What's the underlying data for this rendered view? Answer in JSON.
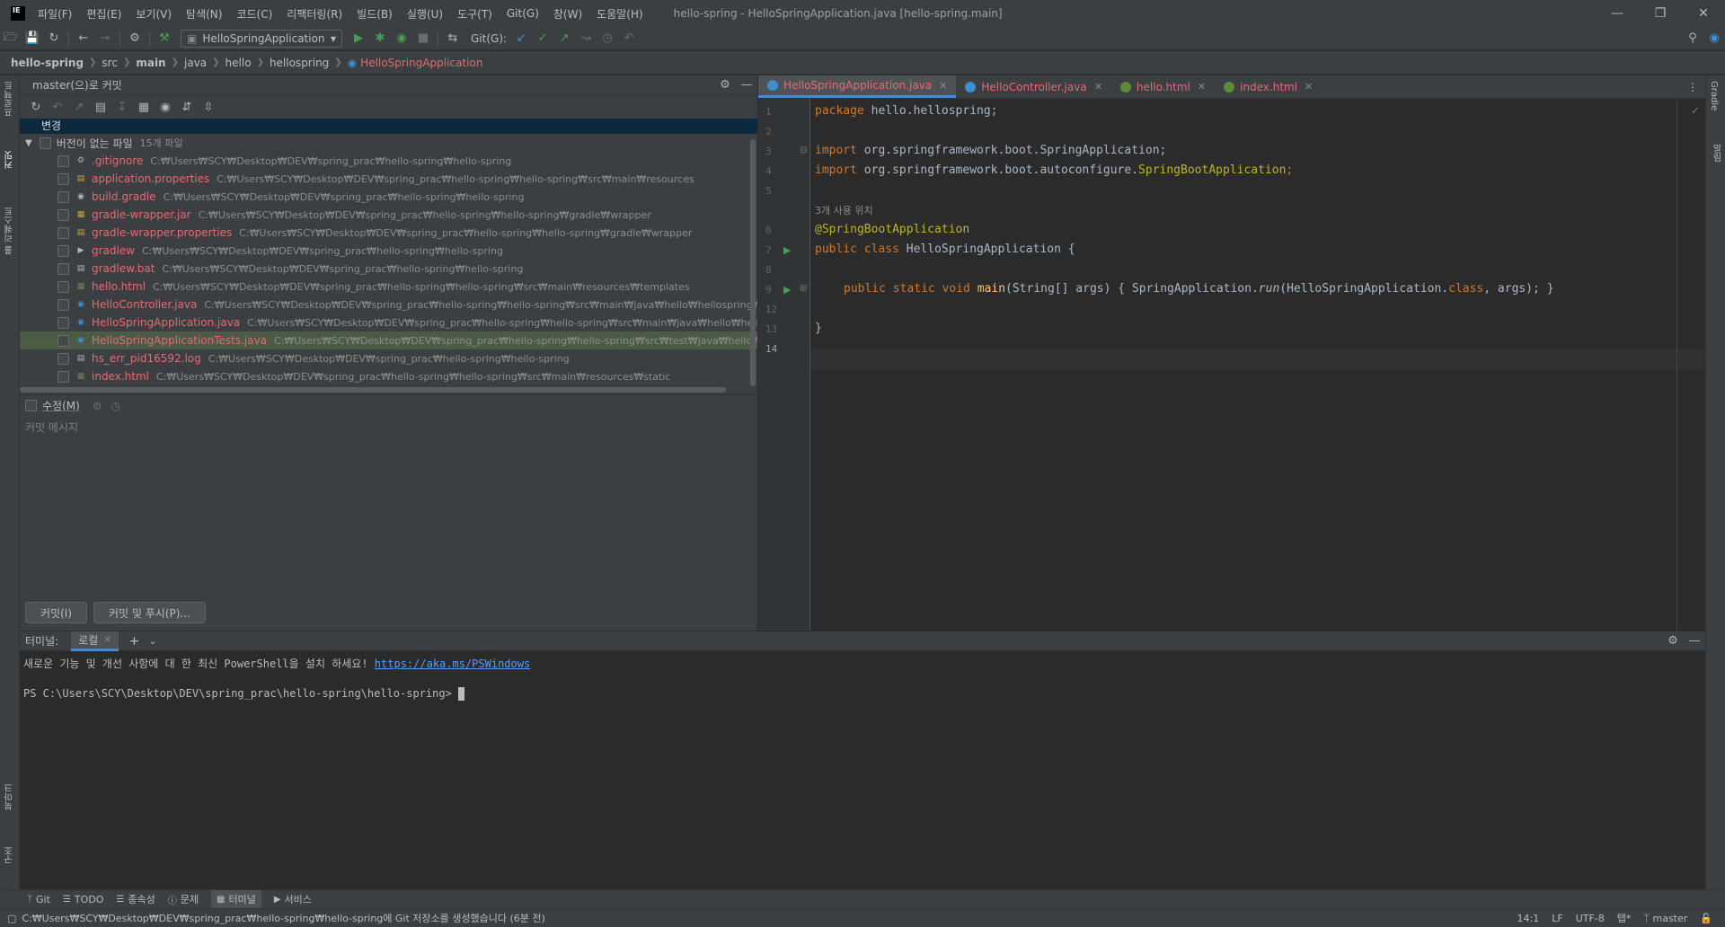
{
  "titlebar": {
    "logo": "IE",
    "menus": [
      "파일(F)",
      "편집(E)",
      "보기(V)",
      "탐색(N)",
      "코드(C)",
      "리팩터링(R)",
      "빌드(B)",
      "실행(U)",
      "도구(T)",
      "Git(G)",
      "창(W)",
      "도움말(H)"
    ],
    "window_title": "hello-spring - HelloSpringApplication.java [hello-spring.main]"
  },
  "toolbar": {
    "run_config": "HelloSpringApplication",
    "git_label": "Git(G):"
  },
  "breadcrumb": [
    "hello-spring",
    "src",
    "main",
    "java",
    "hello",
    "hellospring",
    "HelloSpringApplication"
  ],
  "left_strip": {
    "project": "프로젝트",
    "commit": "커밋",
    "pull_requests": "풀 리퀘스트",
    "bookmarks": "북마크",
    "structure": "구조"
  },
  "right_strip": {
    "gradle": "Gradle",
    "notifications": "알림"
  },
  "commit_panel": {
    "title": "master(으)로 커밋",
    "changes_header": "변경",
    "group_label": "버전이 없는 파일",
    "group_count": "15개 파일",
    "files": [
      {
        "name": ".gitignore",
        "path": "C:₩Users₩SCY₩Desktop₩DEV₩spring_prac₩hello-spring₩hello-spring",
        "icon": "gear-file-icon"
      },
      {
        "name": "application.properties",
        "path": "C:₩Users₩SCY₩Desktop₩DEV₩spring_prac₩hello-spring₩hello-spring₩src₩main₩resources",
        "icon": "properties-file-icon"
      },
      {
        "name": "build.gradle",
        "path": "C:₩Users₩SCY₩Desktop₩DEV₩spring_prac₩hello-spring₩hello-spring",
        "icon": "gradle-file-icon"
      },
      {
        "name": "gradle-wrapper.jar",
        "path": "C:₩Users₩SCY₩Desktop₩DEV₩spring_prac₩hello-spring₩hello-spring₩gradle₩wrapper",
        "icon": "jar-file-icon"
      },
      {
        "name": "gradle-wrapper.properties",
        "path": "C:₩Users₩SCY₩Desktop₩DEV₩spring_prac₩hello-spring₩hello-spring₩gradle₩wrapper",
        "icon": "properties-file-icon"
      },
      {
        "name": "gradlew",
        "path": "C:₩Users₩SCY₩Desktop₩DEV₩spring_prac₩hello-spring₩hello-spring",
        "icon": "script-file-icon"
      },
      {
        "name": "gradlew.bat",
        "path": "C:₩Users₩SCY₩Desktop₩DEV₩spring_prac₩hello-spring₩hello-spring",
        "icon": "bat-file-icon"
      },
      {
        "name": "hello.html",
        "path": "C:₩Users₩SCY₩Desktop₩DEV₩spring_prac₩hello-spring₩hello-spring₩src₩main₩resources₩templates",
        "icon": "html-file-icon"
      },
      {
        "name": "HelloController.java",
        "path": "C:₩Users₩SCY₩Desktop₩DEV₩spring_prac₩hello-spring₩hello-spring₩src₩main₩java₩hello₩hellospring₩controlle",
        "icon": "java-class-icon"
      },
      {
        "name": "HelloSpringApplication.java",
        "path": "C:₩Users₩SCY₩Desktop₩DEV₩spring_prac₩hello-spring₩hello-spring₩src₩main₩java₩hello₩hellospring",
        "icon": "java-class-icon"
      },
      {
        "name": "HelloSpringApplicationTests.java",
        "path": "C:₩Users₩SCY₩Desktop₩DEV₩spring_prac₩hello-spring₩hello-spring₩src₩test₩java₩hello₩hellospri",
        "icon": "java-class-icon",
        "selected": true
      },
      {
        "name": "hs_err_pid16592.log",
        "path": "C:₩Users₩SCY₩Desktop₩DEV₩spring_prac₩hello-spring₩hello-spring",
        "icon": "log-file-icon"
      },
      {
        "name": "index.html",
        "path": "C:₩Users₩SCY₩Desktop₩DEV₩spring_prac₩hello-spring₩hello-spring₩src₩main₩resources₩static",
        "icon": "html-file-icon"
      }
    ],
    "amend_label": "수정(M)",
    "commit_message_placeholder": "커밋 메시지",
    "commit_button": "커밋(I)",
    "commit_push_button": "커밋 및 푸시(P)..."
  },
  "editor": {
    "tabs": [
      {
        "label": "HelloSpringApplication.java",
        "active": true,
        "icon_color": "#3d8fd0"
      },
      {
        "label": "HelloController.java",
        "active": false,
        "icon_color": "#3d8fd0"
      },
      {
        "label": "hello.html",
        "active": false,
        "icon_color": "#5f8a3a"
      },
      {
        "label": "index.html",
        "active": false,
        "icon_color": "#5f8a3a"
      }
    ],
    "line_numbers": [
      "1",
      "2",
      "3",
      "4",
      "5",
      "6",
      "7",
      "8",
      "9",
      "12",
      "13",
      "14"
    ],
    "usage_hint": "3개 사용 위치",
    "code": {
      "l1_kw": "package",
      "l1_rest": " hello.hellospring;",
      "l3_kw": "import",
      "l3_rest": " org.springframework.boot.SpringApplication;",
      "l4_kw": "import",
      "l4_rest_a": " org.springframework.boot.autoconfigure.",
      "l4_rest_b": "SpringBootApplication",
      "l4_semi": ";",
      "l6_ann": "@SpringBootApplication",
      "l7_kw": "public class",
      "l7_rest": " HelloSpringApplication {",
      "l9_kw": "public static void",
      "l9_fn": "main",
      "l9_a": "(String[] args) { SpringApplication.",
      "l9_run": "run",
      "l9_b": "(HelloSpringApplication.",
      "l9_cls": "class",
      "l9_c": ", args); }",
      "l13": "}"
    }
  },
  "terminal": {
    "title": "터미널:",
    "tab": "로컬",
    "notice": "새로운 기능 및 개선 사항에 대 한 최신 PowerShell을 설치 하세요! ",
    "link": "https://aka.ms/PSWindows",
    "prompt": "PS C:\\Users\\SCY\\Desktop\\DEV\\spring_prac\\hello-spring\\hello-spring> "
  },
  "bottom_tabs": [
    "Git",
    "TODO",
    "종속성",
    "문제",
    "터미널",
    "서비스"
  ],
  "status": {
    "message": "C:₩Users₩SCY₩Desktop₩DEV₩spring_prac₩hello-spring₩hello-spring에 Git 저장소를 생성했습니다 (6분 전)",
    "position": "14:1",
    "line_sep": "LF",
    "encoding": "UTF-8",
    "indent": "탭*",
    "branch": "master"
  }
}
